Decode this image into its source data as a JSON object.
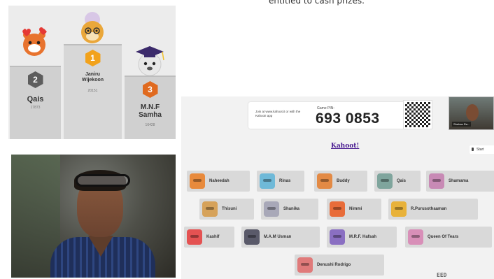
{
  "caption": "entitled to cash prizes.",
  "podium": {
    "first": {
      "rank": "1",
      "name": "Janiru Wijekoon",
      "score": "20151",
      "avatar": "grandma-cat-icon",
      "medal_color": "#f2a21b"
    },
    "second": {
      "rank": "2",
      "name": "Qais",
      "score": "17873",
      "avatar": "tiger-hearts-icon",
      "medal_color": "#5d5d5d"
    },
    "third": {
      "rank": "3",
      "name": "M.N.F Samha",
      "score": "16428",
      "avatar": "graduate-bear-icon",
      "medal_color": "#e06a1f"
    }
  },
  "lobby": {
    "join_instructions": "Join at www.kahoot.it or with the Kahoot! app",
    "pin_label": "Game PIN:",
    "pin": "693 0853",
    "logo": "Kahoot!",
    "start_button": "Start",
    "pip_label": "Shehan Ra...",
    "ticker": "EED",
    "players": [
      {
        "name": "Naheedah",
        "avatar_color": "#e88a3c"
      },
      {
        "name": "Rinas",
        "avatar_color": "#6fb9d8"
      },
      {
        "name": "Buddy",
        "avatar_color": "#e38a45"
      },
      {
        "name": "Qais",
        "avatar_color": "#7fa59d"
      },
      {
        "name": "Shamama",
        "avatar_color": "#c88ab5"
      },
      {
        "name": "Thisuni",
        "avatar_color": "#d6a25a"
      },
      {
        "name": "Shanika",
        "avatar_color": "#a8a8b8"
      },
      {
        "name": "Nimmi",
        "avatar_color": "#e86c3a"
      },
      {
        "name": "R.Purusothaaman",
        "avatar_color": "#e8b23a"
      },
      {
        "name": "Kashif",
        "avatar_color": "#e45252"
      },
      {
        "name": "M.A.M Usman",
        "avatar_color": "#5a5a6a"
      },
      {
        "name": "M.R.F. Hafsah",
        "avatar_color": "#8a6fc2"
      },
      {
        "name": "Queen Of Tears",
        "avatar_color": "#d88fb8"
      },
      {
        "name": "Denushi Rodrigo",
        "avatar_color": "#e07a7a"
      }
    ]
  }
}
